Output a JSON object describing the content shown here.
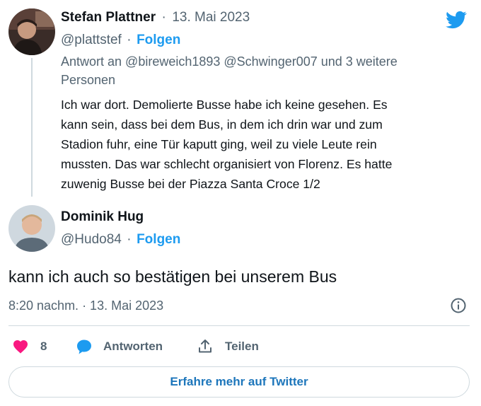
{
  "tweet1": {
    "author_name": "Stefan Plattner",
    "separator": "·",
    "date": "13. Mai 2023",
    "handle": "@plattstef",
    "handle_dot": "·",
    "follow_label": "Folgen",
    "reply_line1": "Antwort an @bireweich1893 @Schwinger007 und 3 weitere",
    "reply_line2": "Personen",
    "text_lines": [
      "Ich war dort. Demolierte Busse habe ich keine gesehen. Es",
      "kann sein, dass bei dem Bus, in dem ich drin war und zum",
      "Stadion fuhr, eine Tür kaputt ging, weil zu viele Leute rein",
      "mussten. Das war schlecht organisiert von Florenz. Es hatte",
      "zuwenig Busse bei der Piazza Santa Croce 1/2"
    ]
  },
  "tweet2": {
    "author_name": "Dominik Hug",
    "handle": "@Hudo84",
    "handle_dot": "·",
    "follow_label": "Folgen",
    "text": "kann ich auch so bestätigen bei unserem Bus",
    "timestamp": "8:20 nachm. · 13. Mai 2023"
  },
  "actions": {
    "like_count": "8",
    "reply_label": "Antworten",
    "share_label": "Teilen"
  },
  "more_button_label": "Erfahre mehr auf Twitter",
  "icons": {
    "brand": "twitter-bird-icon",
    "info": "info-icon",
    "like": "heart-icon",
    "reply": "speech-bubble-icon",
    "share": "share-upload-icon"
  },
  "colors": {
    "brand": "#1d9bf0",
    "like": "#f91880",
    "secondary_text": "#536471"
  }
}
